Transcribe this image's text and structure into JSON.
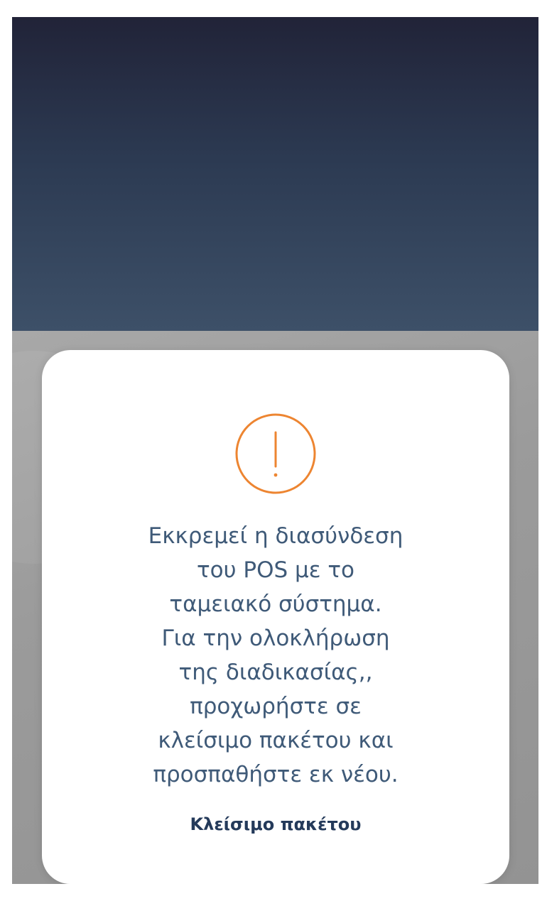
{
  "dialog": {
    "icon": "warning-exclamation-icon",
    "accent_color": "#ed8531",
    "message_lines": [
      "Εκκρεμεί η διασύνδεση",
      "του POS με το",
      "ταμειακό σύστημα.",
      "Για την ολοκλήρωση",
      "της διαδικασίας,,",
      "προχωρήστε σε",
      "κλείσιμο πακέτου και",
      "προσπαθήστε εκ νέου."
    ],
    "action_label": "Κλείσιμο πακέτου"
  },
  "colors": {
    "header_top": "#212338",
    "header_bottom": "#3d5068",
    "overlay": "#9a9a9a",
    "message_text": "#3f5a78",
    "action_text": "#243a5a"
  }
}
